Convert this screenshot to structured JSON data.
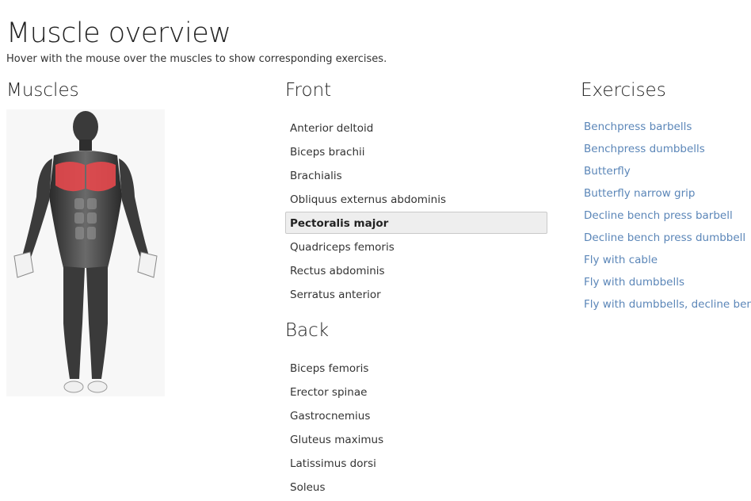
{
  "page": {
    "title": "Muscle overview",
    "subtitle": "Hover with the mouse over the muscles to show corresponding exercises."
  },
  "headings": {
    "muscles": "Muscles",
    "front": "Front",
    "back": "Back",
    "exercises": "Exercises"
  },
  "front_muscles": [
    {
      "label": "Anterior deltoid"
    },
    {
      "label": "Biceps brachii"
    },
    {
      "label": "Brachialis"
    },
    {
      "label": "Obliquus externus abdominis"
    },
    {
      "label": "Pectoralis major",
      "active": true
    },
    {
      "label": "Quadriceps femoris"
    },
    {
      "label": "Rectus abdominis"
    },
    {
      "label": "Serratus anterior"
    }
  ],
  "back_muscles": [
    {
      "label": "Biceps femoris"
    },
    {
      "label": "Erector spinae"
    },
    {
      "label": "Gastrocnemius"
    },
    {
      "label": "Gluteus maximus"
    },
    {
      "label": "Latissimus dorsi"
    },
    {
      "label": "Soleus"
    }
  ],
  "exercises": [
    "Benchpress barbells",
    "Benchpress dumbbells",
    "Butterfly",
    "Butterfly narrow grip",
    "Decline bench press barbell",
    "Decline bench press dumbbell",
    "Fly with cable",
    "Fly with dumbbells",
    "Fly with dumbbells, decline bench"
  ],
  "colors": {
    "highlight_muscle": "#e5484d",
    "link": "#5b86b8",
    "active_bg": "#eeeeee"
  }
}
